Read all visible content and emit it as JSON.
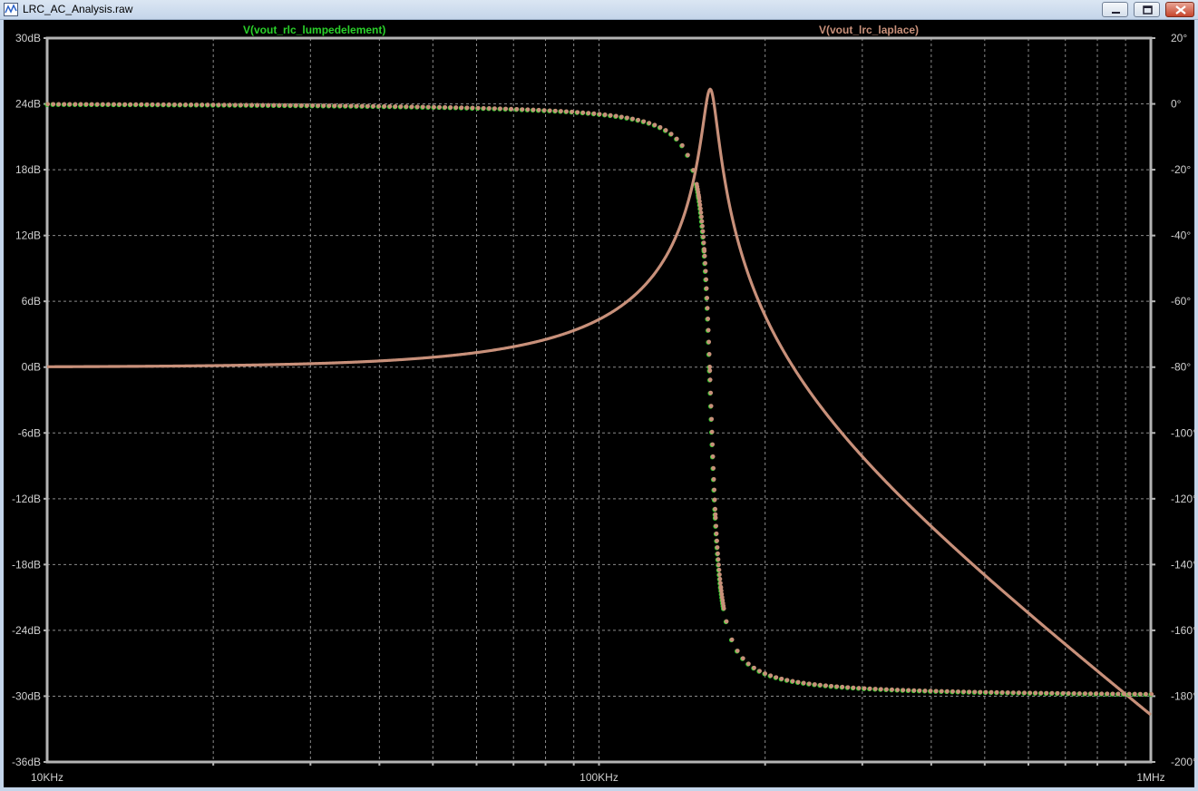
{
  "window": {
    "title": "LRC_AC_Analysis.raw",
    "icon": "waveform-viewer-icon"
  },
  "colors": {
    "background": "#000000",
    "grid": "#8a8a8a",
    "frame": "#b4b4b4",
    "series_lumped": "#2ad12a",
    "series_laplace": "#c8907a",
    "axis_text": "#d0d0d0"
  },
  "chart_data": {
    "type": "line",
    "title": "",
    "x_scale": "log",
    "xlim": [
      10000,
      1000000
    ],
    "x_ticks": [
      {
        "value": 10000,
        "label": "10KHz"
      },
      {
        "value": 100000,
        "label": "100KHz"
      },
      {
        "value": 1000000,
        "label": "1MHz"
      }
    ],
    "ylim_left": [
      -36,
      30
    ],
    "y_ticks_left": [
      "30dB",
      "24dB",
      "18dB",
      "12dB",
      "6dB",
      "0dB",
      "-6dB",
      "-12dB",
      "-18dB",
      "-24dB",
      "-30dB",
      "-36dB"
    ],
    "y_ticks_left_values": [
      30,
      24,
      18,
      12,
      6,
      0,
      -6,
      -12,
      -18,
      -24,
      -30,
      -36
    ],
    "ylim_right": [
      -200,
      20
    ],
    "y_ticks_right": [
      "20°",
      "0°",
      "-20°",
      "-40°",
      "-60°",
      "-80°",
      "-100°",
      "-120°",
      "-140°",
      "-160°",
      "-180°",
      "-200°"
    ],
    "y_ticks_right_values": [
      20,
      0,
      -20,
      -40,
      -60,
      -80,
      -100,
      -120,
      -140,
      -160,
      -180,
      -200
    ],
    "grid": true,
    "legend": [
      "V(vout_rlc_lumpedelement)",
      "V(vout_lrc_laplace)"
    ],
    "resonance": {
      "f0": 159155,
      "Q": 18.5
    },
    "series": [
      {
        "name": "V(vout_rlc_lumpedelement)",
        "quantity": "magnitude",
        "axis": "left",
        "style": "solid",
        "color": "#2ad12a"
      },
      {
        "name": "V(vout_rlc_lumpedelement)",
        "quantity": "phase",
        "axis": "right",
        "style": "dotted",
        "color": "#2ad12a"
      },
      {
        "name": "V(vout_lrc_laplace)",
        "quantity": "magnitude",
        "axis": "left",
        "style": "solid",
        "color": "#c8907a"
      },
      {
        "name": "V(vout_lrc_laplace)",
        "quantity": "phase",
        "axis": "right",
        "style": "dotted",
        "color": "#c8907a"
      }
    ],
    "sample_points": {
      "magnitude_db": [
        {
          "f": 10000,
          "v": 0.0
        },
        {
          "f": 30000,
          "v": 0.3
        },
        {
          "f": 50000,
          "v": 0.9
        },
        {
          "f": 80000,
          "v": 2.7
        },
        {
          "f": 100000,
          "v": 4.5
        },
        {
          "f": 130000,
          "v": 10.0
        },
        {
          "f": 159155,
          "v": 25.3
        },
        {
          "f": 200000,
          "v": 7.5
        },
        {
          "f": 300000,
          "v": -6.0
        },
        {
          "f": 500000,
          "v": -18.0
        },
        {
          "f": 1000000,
          "v": -31.8
        }
      ],
      "phase_deg": [
        {
          "f": 10000,
          "v": 0
        },
        {
          "f": 50000,
          "v": -0.6
        },
        {
          "f": 100000,
          "v": -3.3
        },
        {
          "f": 140000,
          "v": -16
        },
        {
          "f": 159155,
          "v": -90
        },
        {
          "f": 180000,
          "v": -164
        },
        {
          "f": 250000,
          "v": -177
        },
        {
          "f": 500000,
          "v": -179
        },
        {
          "f": 1000000,
          "v": -180
        }
      ]
    }
  }
}
